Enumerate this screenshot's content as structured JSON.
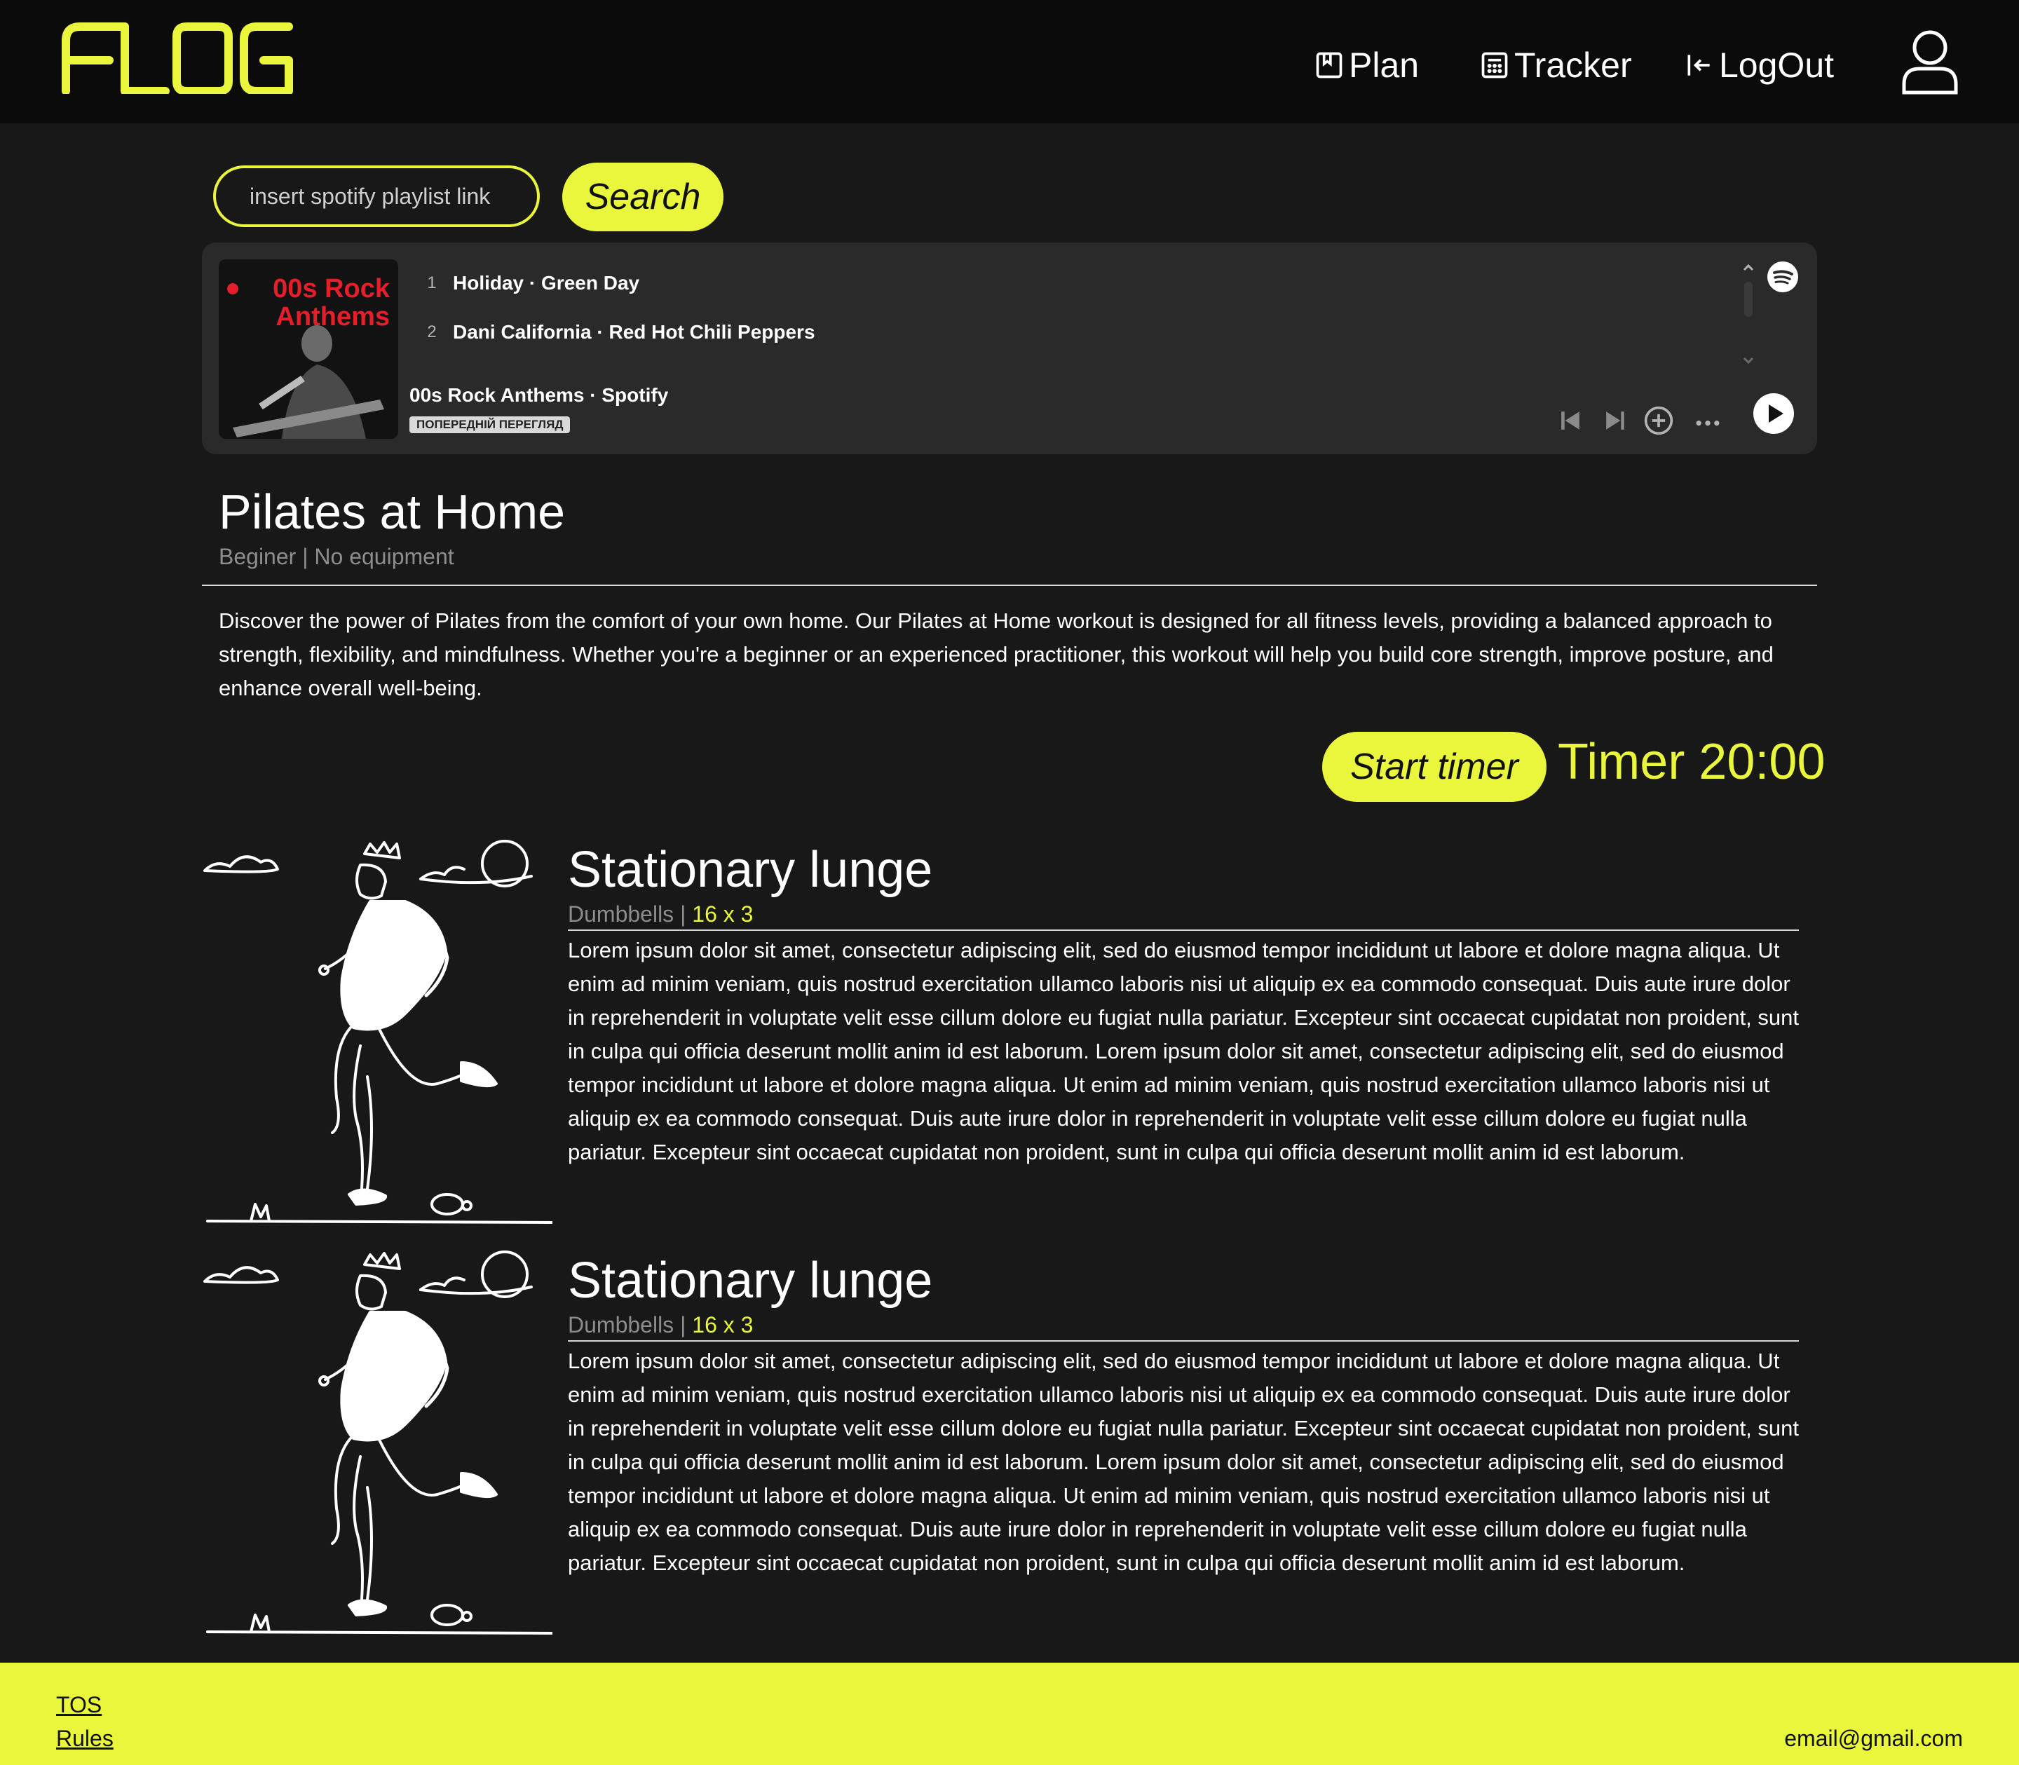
{
  "header": {
    "logo_text": "FLOG",
    "nav": [
      {
        "label": "Plan",
        "icon": "bookmark-icon"
      },
      {
        "label": "Tracker",
        "icon": "calculator-icon"
      },
      {
        "label": "LogOut",
        "icon": "logout-icon"
      }
    ],
    "avatar_icon": "user-icon"
  },
  "search": {
    "placeholder": "insert spotify playlist link",
    "button_label": "Search"
  },
  "spotify": {
    "cover_title": "00s Rock Anthems",
    "tracks": [
      {
        "num": "1",
        "title": "Holiday · Green Day"
      },
      {
        "num": "2",
        "title": "Dani California · Red Hot Chili Peppers"
      }
    ],
    "playlist_name": "00s Rock Anthems · Spotify",
    "preview_badge": "ПОПЕРЕДНІЙ ПЕРЕГЛЯД"
  },
  "workout": {
    "title": "Pilates at Home",
    "meta": "Beginer | No equipment",
    "description": "Discover the power of Pilates from the comfort of your own home. Our Pilates at Home workout is designed for all fitness levels, providing a balanced approach to strength, flexibility, and mindfulness. Whether you're a beginner or an experienced practitioner, this workout will help you build core strength, improve posture, and enhance overall well-being.",
    "start_timer_label": "Start timer",
    "timer_label": "Timer 20:00"
  },
  "exercises": [
    {
      "title": "Stationary lunge",
      "equipment": "Dumbbells",
      "separator": " | ",
      "reps": "16 x 3",
      "description": "Lorem ipsum dolor sit amet, consectetur adipiscing elit, sed do eiusmod tempor incididunt ut labore et dolore magna aliqua. Ut enim ad minim veniam, quis nostrud exercitation ullamco laboris nisi ut aliquip ex ea commodo consequat. Duis aute irure dolor in reprehenderit in voluptate velit esse cillum dolore eu fugiat nulla pariatur. Excepteur sint occaecat cupidatat non proident, sunt in culpa qui officia deserunt mollit anim id est laborum. Lorem ipsum dolor sit amet, consectetur adipiscing elit, sed do eiusmod tempor incididunt ut labore et dolore magna aliqua. Ut enim ad minim veniam, quis nostrud exercitation ullamco laboris nisi ut aliquip ex ea commodo consequat. Duis aute irure dolor in reprehenderit in voluptate velit esse cillum dolore eu fugiat nulla pariatur. Excepteur sint occaecat cupidatat non proident, sunt in culpa qui officia deserunt mollit anim id est laborum."
    },
    {
      "title": "Stationary lunge",
      "equipment": "Dumbbells",
      "separator": " | ",
      "reps": "16 x 3",
      "description": "Lorem ipsum dolor sit amet, consectetur adipiscing elit, sed do eiusmod tempor incididunt ut labore et dolore magna aliqua. Ut enim ad minim veniam, quis nostrud exercitation ullamco laboris nisi ut aliquip ex ea commodo consequat. Duis aute irure dolor in reprehenderit in voluptate velit esse cillum dolore eu fugiat nulla pariatur. Excepteur sint occaecat cupidatat non proident, sunt in culpa qui officia deserunt mollit anim id est laborum. Lorem ipsum dolor sit amet, consectetur adipiscing elit, sed do eiusmod tempor incididunt ut labore et dolore magna aliqua. Ut enim ad minim veniam, quis nostrud exercitation ullamco laboris nisi ut aliquip ex ea commodo consequat. Duis aute irure dolor in reprehenderit in voluptate velit esse cillum dolore eu fugiat nulla pariatur. Excepteur sint occaecat cupidatat non proident, sunt in culpa qui officia deserunt mollit anim id est laborum."
    }
  ],
  "footer": {
    "links": [
      "TOS",
      "Rules"
    ],
    "email": "email@gmail.com"
  },
  "colors": {
    "accent": "#eaf63c",
    "background": "#181818",
    "header_bg": "#0b0b0b",
    "spotify_card": "#2a2a2a",
    "cover_red": "#e41e2a"
  }
}
